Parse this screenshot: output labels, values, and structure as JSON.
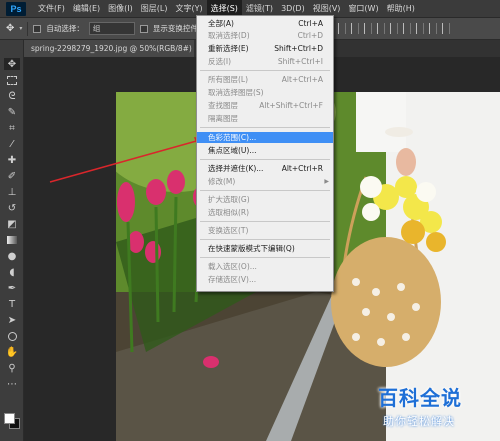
{
  "app": {
    "logo": "Ps"
  },
  "menubar": {
    "items": [
      "文件(F)",
      "编辑(E)",
      "图像(I)",
      "图层(L)",
      "文字(Y)",
      "选择(S)",
      "滤镜(T)",
      "3D(D)",
      "视图(V)",
      "窗口(W)",
      "帮助(H)"
    ],
    "active_index": 5
  },
  "options": {
    "auto_select_label": "自动选择：",
    "auto_select_value": "组",
    "show_transform_label": "显示变换控件"
  },
  "document": {
    "tab_title": "spring-2298279_1920.jpg @ 50%(RGB/8#)"
  },
  "menu": {
    "items": [
      {
        "label": "全部(A)",
        "shortcut": "Ctrl+A",
        "enabled": true
      },
      {
        "label": "取消选择(D)",
        "shortcut": "Ctrl+D",
        "enabled": false
      },
      {
        "label": "重新选择(E)",
        "shortcut": "Shift+Ctrl+D",
        "enabled": true
      },
      {
        "label": "反选(I)",
        "shortcut": "Shift+Ctrl+I",
        "enabled": false
      },
      {
        "label": "所有图层(L)",
        "shortcut": "Alt+Ctrl+A",
        "enabled": false
      },
      {
        "label": "取消选择图层(S)",
        "shortcut": "",
        "enabled": false
      },
      {
        "label": "查找图层",
        "shortcut": "Alt+Shift+Ctrl+F",
        "enabled": false
      },
      {
        "label": "隔离图层",
        "shortcut": "",
        "enabled": false
      },
      {
        "label": "色彩范围(C)...",
        "shortcut": "",
        "enabled": true,
        "highlighted": true
      },
      {
        "label": "焦点区域(U)...",
        "shortcut": "",
        "enabled": true
      },
      {
        "label": "选择并遮住(K)...",
        "shortcut": "Alt+Ctrl+R",
        "enabled": true
      },
      {
        "label": "修改(M)",
        "shortcut": "",
        "enabled": false,
        "submenu": true
      },
      {
        "label": "扩大选取(G)",
        "shortcut": "",
        "enabled": false
      },
      {
        "label": "选取相似(R)",
        "shortcut": "",
        "enabled": false
      },
      {
        "label": "变换选区(T)",
        "shortcut": "",
        "enabled": false
      },
      {
        "label": "在快速蒙版模式下编辑(Q)",
        "shortcut": "",
        "enabled": true
      },
      {
        "label": "载入选区(O)...",
        "shortcut": "",
        "enabled": false
      },
      {
        "label": "存储选区(V)...",
        "shortcut": "",
        "enabled": false
      }
    ]
  },
  "watermark": {
    "main": "百科全说",
    "sub": "助你轻松解决"
  },
  "colors": {
    "menu_highlight": "#3f8ff5",
    "ps_blue": "#31a8ff",
    "watermark_blue": "#1e6fd6",
    "arrow_red": "#d9262b"
  }
}
